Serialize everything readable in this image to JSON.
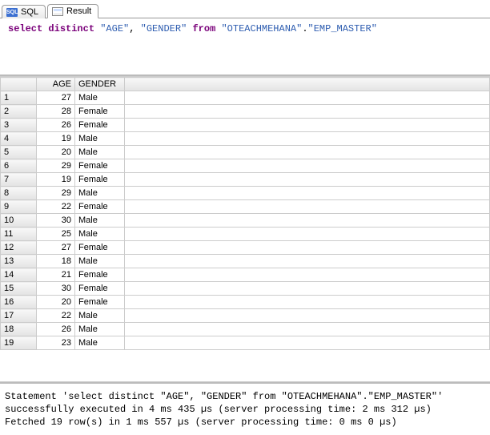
{
  "tabs": {
    "sql": "SQL",
    "result": "Result"
  },
  "sql": {
    "kw_select": "select",
    "kw_distinct": "distinct",
    "kw_from": "from",
    "str_age": "\"AGE\"",
    "str_gender": "\"GENDER\"",
    "str_schema": "\"OTEACHMEHANA\"",
    "str_table": "\"EMP_MASTER\"",
    "comma": ", ",
    "dot": "."
  },
  "grid": {
    "columns": [
      "AGE",
      "GENDER"
    ],
    "rows": [
      {
        "n": "1",
        "age": "27",
        "gender": "Male"
      },
      {
        "n": "2",
        "age": "28",
        "gender": "Female"
      },
      {
        "n": "3",
        "age": "26",
        "gender": "Female"
      },
      {
        "n": "4",
        "age": "19",
        "gender": "Male"
      },
      {
        "n": "5",
        "age": "20",
        "gender": "Male"
      },
      {
        "n": "6",
        "age": "29",
        "gender": "Female"
      },
      {
        "n": "7",
        "age": "19",
        "gender": "Female"
      },
      {
        "n": "8",
        "age": "29",
        "gender": "Male"
      },
      {
        "n": "9",
        "age": "22",
        "gender": "Female"
      },
      {
        "n": "10",
        "age": "30",
        "gender": "Male"
      },
      {
        "n": "11",
        "age": "25",
        "gender": "Male"
      },
      {
        "n": "12",
        "age": "27",
        "gender": "Female"
      },
      {
        "n": "13",
        "age": "18",
        "gender": "Male"
      },
      {
        "n": "14",
        "age": "21",
        "gender": "Female"
      },
      {
        "n": "15",
        "age": "30",
        "gender": "Female"
      },
      {
        "n": "16",
        "age": "20",
        "gender": "Female"
      },
      {
        "n": "17",
        "age": "22",
        "gender": "Male"
      },
      {
        "n": "18",
        "age": "26",
        "gender": "Male"
      },
      {
        "n": "19",
        "age": "23",
        "gender": "Male"
      }
    ]
  },
  "status": {
    "line1": "Statement 'select distinct \"AGE\", \"GENDER\" from \"OTEACHMEHANA\".\"EMP_MASTER\"'",
    "line2": "successfully executed in 4 ms 435 µs  (server processing time: 2 ms 312 µs)",
    "line3": "Fetched 19 row(s) in 1 ms 557 µs (server processing time: 0 ms 0 µs)"
  },
  "chart_data": {
    "type": "table",
    "title": "select distinct \"AGE\", \"GENDER\" from \"OTEACHMEHANA\".\"EMP_MASTER\"",
    "columns": [
      "AGE",
      "GENDER"
    ],
    "rows": [
      [
        27,
        "Male"
      ],
      [
        28,
        "Female"
      ],
      [
        26,
        "Female"
      ],
      [
        19,
        "Male"
      ],
      [
        20,
        "Male"
      ],
      [
        29,
        "Female"
      ],
      [
        19,
        "Female"
      ],
      [
        29,
        "Male"
      ],
      [
        22,
        "Female"
      ],
      [
        30,
        "Male"
      ],
      [
        25,
        "Male"
      ],
      [
        27,
        "Female"
      ],
      [
        18,
        "Male"
      ],
      [
        21,
        "Female"
      ],
      [
        30,
        "Female"
      ],
      [
        20,
        "Female"
      ],
      [
        22,
        "Male"
      ],
      [
        26,
        "Male"
      ],
      [
        23,
        "Male"
      ]
    ]
  }
}
